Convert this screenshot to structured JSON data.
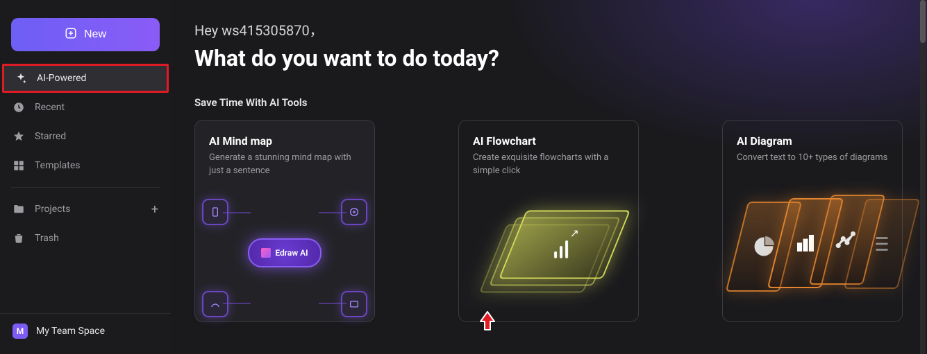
{
  "sidebar": {
    "new_label": "New",
    "items": [
      {
        "label": "AI-Powered"
      },
      {
        "label": "Recent"
      },
      {
        "label": "Starred"
      },
      {
        "label": "Templates"
      },
      {
        "label": "Projects"
      },
      {
        "label": "Trash"
      }
    ],
    "team": {
      "badge": "M",
      "label": "My Team Space"
    }
  },
  "main": {
    "greeting": "Hey ws415305870，",
    "headline": "What do you want to do today?",
    "section_title": "Save Time With AI Tools",
    "cards": [
      {
        "title": "AI Mind map",
        "desc": "Generate a stunning mind map with just a sentence",
        "core_label": "Edraw AI"
      },
      {
        "title": "AI Flowchart",
        "desc": "Create exquisite flowcharts with a simple click"
      },
      {
        "title": "AI Diagram",
        "desc": "Convert text to 10+ types of diagrams"
      }
    ]
  }
}
